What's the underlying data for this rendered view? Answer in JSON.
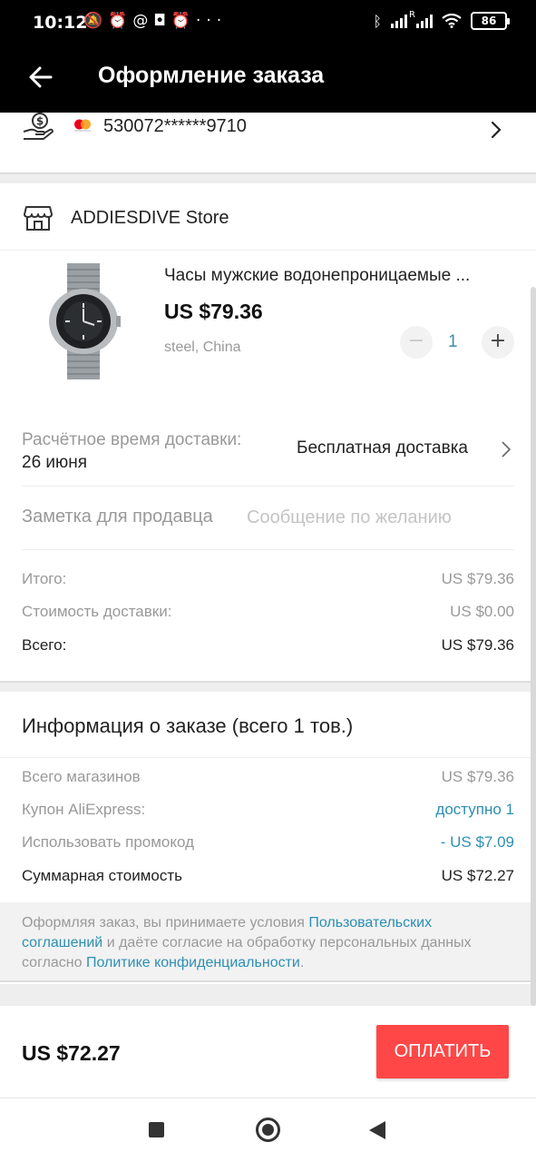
{
  "status_bar": {
    "time": "10:12",
    "left_icons": [
      "bell-off-icon",
      "alarm-icon",
      "at-icon",
      "instagram-icon",
      "alarm-icon"
    ],
    "more": "···",
    "network_badge": "R",
    "battery": "86",
    "right_icons": [
      "bluetooth-icon",
      "signal-icon",
      "signal-icon",
      "wifi-icon",
      "battery-icon"
    ]
  },
  "header": {
    "title": "Оформление заказа",
    "back_icon": "arrow-left-icon",
    "background": "#000000"
  },
  "payment": {
    "icon": "hand-coin-icon",
    "card_brand_icon": "mastercard-icon",
    "card_number": "530072******9710"
  },
  "store": {
    "icon": "store-icon",
    "name": "ADDIESDIVE Store"
  },
  "product": {
    "image_icon": "watch-icon",
    "title": "Часы мужские водонепроницаемые ...",
    "price": "US $79.36",
    "variant": "steel, China",
    "quantity": "1",
    "minus": "−",
    "plus": "+"
  },
  "delivery": {
    "label": "Расчётное время доставки:",
    "date": "26 июня",
    "method": "Бесплатная доставка"
  },
  "seller_note": {
    "label": "Заметка для продавца",
    "placeholder": "Сообщение по желанию"
  },
  "store_totals": {
    "subtotal_label": "Итого:",
    "subtotal_value": "US $79.36",
    "shipping_label": "Стоимость доставки:",
    "shipping_value": "US $0.00",
    "total_label": "Всего:",
    "total_value": "US $79.36"
  },
  "order_info": {
    "title": "Информация о заказе (всего 1 тов.)",
    "stores_label": "Всего магазинов",
    "stores_value": "US $79.36",
    "coupon_label": "Купон AliExpress:",
    "coupon_value": "доступно 1",
    "promo_label": "Использовать промокод",
    "promo_value": "- US $7.09",
    "sum_label": "Суммарная стоимость",
    "sum_value": "US $72.27"
  },
  "terms": {
    "text1": "Оформляя заказ, вы принимаете условия ",
    "link1": "Пользовательских соглашений",
    "text2": " и даёте согласие на обработку персональных данных согласно ",
    "link2": "Политике конфиденциальности",
    "text3": "."
  },
  "bottom": {
    "total": "US $72.27",
    "pay_label": "ОПЛАТИТЬ"
  },
  "nav": {
    "icons": [
      "recents-square-icon",
      "home-circle-icon",
      "back-triangle-icon"
    ]
  },
  "colors": {
    "accent_red": "#ff4747",
    "link_blue": "#2d8fb3",
    "muted_text": "#999999"
  }
}
